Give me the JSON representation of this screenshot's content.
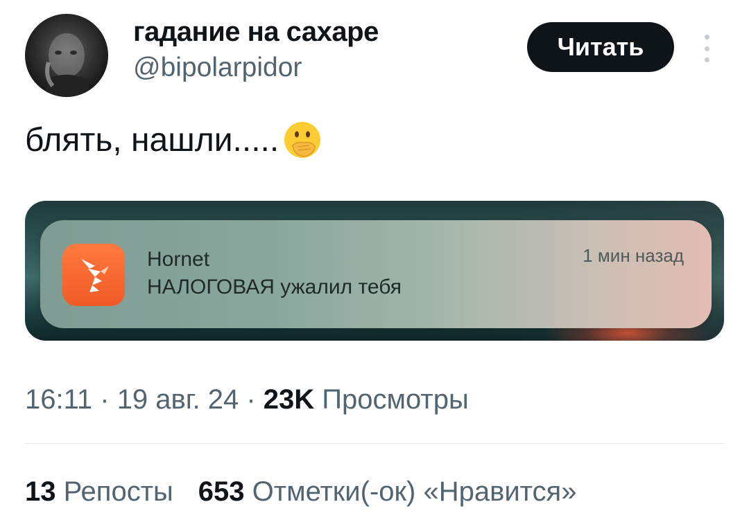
{
  "author": {
    "display_name": "гадание на сахаре",
    "handle": "@bipolarpidor"
  },
  "follow_button": {
    "label": "Читать"
  },
  "tweet": {
    "text": "блять, нашли.....",
    "emoji": "face-with-hand-over-mouth"
  },
  "notification": {
    "app_name": "Hornet",
    "message": "НАЛОГОВАЯ ужалил тебя",
    "time": "1 мин назад"
  },
  "meta": {
    "time": "16:11",
    "sep1": " · ",
    "date": "19 авг. 24",
    "sep2": " · ",
    "views_count": "23K",
    "views_label": " Просмотры"
  },
  "stats": {
    "reposts_count": "13",
    "reposts_label": " Репосты",
    "likes_count": "653",
    "likes_label": " Отметки(-ок) «Нравится»"
  },
  "colors": {
    "text_primary": "#0f1419",
    "text_secondary": "#536471",
    "button_bg": "#0f1419",
    "app_icon": "#f05a28"
  }
}
